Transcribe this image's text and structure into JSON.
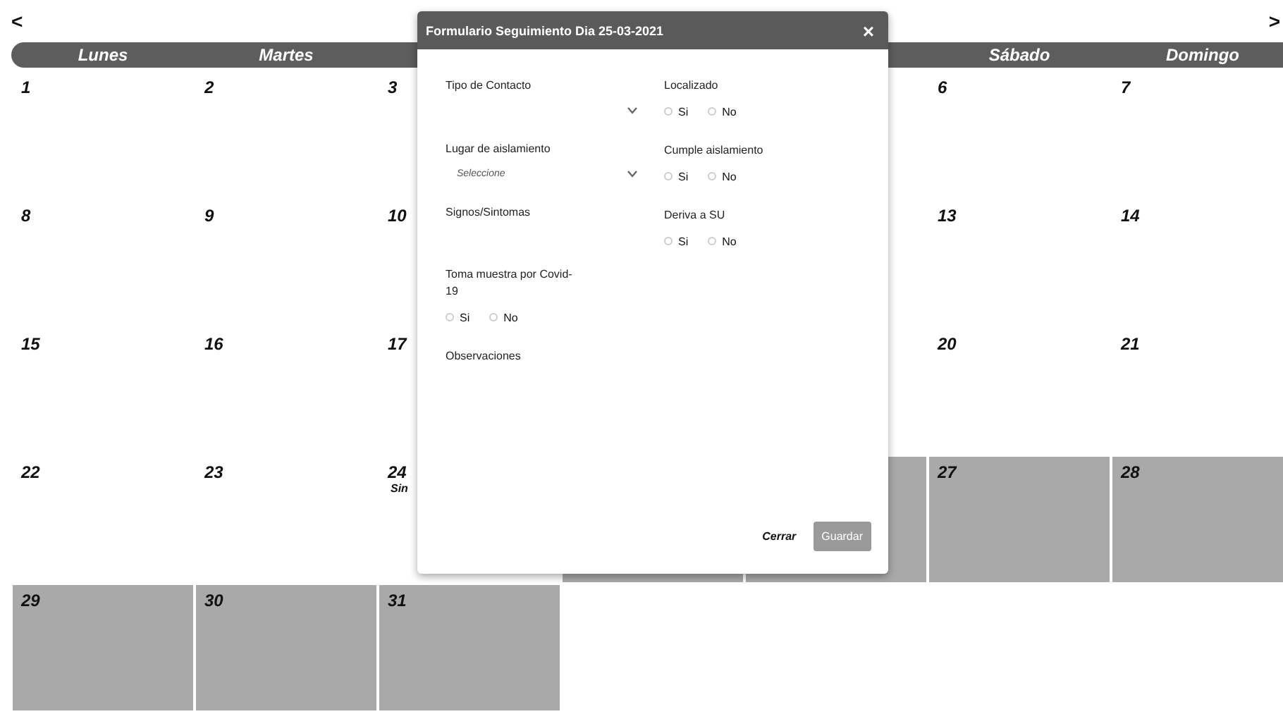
{
  "nav": {
    "prev": "<",
    "next": ">"
  },
  "weekdays": [
    {
      "label": "Lunes"
    },
    {
      "label": "Martes"
    },
    {
      "label": "Sábado"
    },
    {
      "label": "Domingo"
    }
  ],
  "weeks": [
    {
      "start": [
        {
          "number": "1",
          "shaded": false
        },
        {
          "number": "2",
          "shaded": false
        },
        {
          "number": "3",
          "shaded": false
        }
      ],
      "end": [
        {
          "number": "6",
          "shaded": false
        },
        {
          "number": "7",
          "shaded": false
        }
      ]
    },
    {
      "start": [
        {
          "number": "8",
          "shaded": false
        },
        {
          "number": "9",
          "shaded": false
        },
        {
          "number": "10",
          "shaded": false
        }
      ],
      "end": [
        {
          "number": "13",
          "shaded": false
        },
        {
          "number": "14",
          "shaded": false
        }
      ]
    },
    {
      "start": [
        {
          "number": "15",
          "shaded": false
        },
        {
          "number": "16",
          "shaded": false
        },
        {
          "number": "17",
          "shaded": false
        }
      ],
      "end": [
        {
          "number": "20",
          "shaded": false
        },
        {
          "number": "21",
          "shaded": false
        }
      ]
    },
    {
      "start": [
        {
          "number": "22",
          "shaded": false
        },
        {
          "number": "23",
          "shaded": false
        },
        {
          "number": "24",
          "note": "Sin",
          "shaded": false
        }
      ],
      "covered": [
        {
          "shaded": true
        },
        {
          "shaded": true
        }
      ],
      "end": [
        {
          "number": "27",
          "shaded": true
        },
        {
          "number": "28",
          "shaded": true
        }
      ]
    },
    {
      "start": [
        {
          "number": "29",
          "shaded": true
        },
        {
          "number": "30",
          "shaded": true
        },
        {
          "number": "31",
          "shaded": true
        }
      ]
    }
  ],
  "modal": {
    "title": "Formulario Seguimiento Dia 25-03-2021",
    "close": "×",
    "left": [
      {
        "kind": "select",
        "label": "Tipo de Contacto"
      },
      {
        "kind": "select",
        "label": "Lugar de aislamiento",
        "placeholder": "Seleccione"
      },
      {
        "kind": "text",
        "label": "Signos/Sintomas"
      },
      {
        "kind": "radio",
        "label": "Toma muestra por Covid-19",
        "options": [
          {
            "label": "Si",
            "selected": false
          },
          {
            "label": "No",
            "selected": false
          }
        ]
      },
      {
        "kind": "text",
        "label": "Observaciones"
      }
    ],
    "right": [
      {
        "kind": "radio",
        "label": "Localizado",
        "options": [
          {
            "label": "Si",
            "selected": false
          },
          {
            "label": "No",
            "selected": false
          }
        ]
      },
      {
        "kind": "radio",
        "label": "Cumple aislamiento",
        "options": [
          {
            "label": "Si",
            "selected": false
          },
          {
            "label": "No",
            "selected": false
          }
        ]
      },
      {
        "kind": "radio",
        "label": "Deriva a SU",
        "options": [
          {
            "label": "Si",
            "selected": false
          },
          {
            "label": "No",
            "selected": false
          }
        ]
      }
    ],
    "buttons": [
      {
        "label": "Cerrar",
        "kind": "link"
      },
      {
        "label": "Guardar",
        "kind": "primary"
      }
    ]
  }
}
